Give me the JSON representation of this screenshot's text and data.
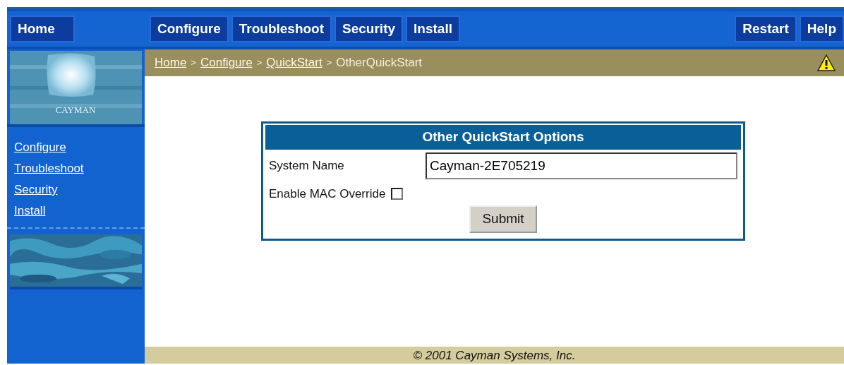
{
  "nav": {
    "home": {
      "label": "Home"
    },
    "main": [
      {
        "label": "Configure"
      },
      {
        "label": "Troubleshoot"
      },
      {
        "label": "Security"
      },
      {
        "label": "Install"
      }
    ],
    "right": [
      {
        "label": "Restart"
      },
      {
        "label": "Help"
      }
    ]
  },
  "logo": {
    "text": "CAYMAN"
  },
  "breadcrumb": {
    "links": [
      {
        "label": "Home"
      },
      {
        "label": "Configure"
      },
      {
        "label": "QuickStart"
      }
    ],
    "separator": ">",
    "current": "OtherQuickStart"
  },
  "sidebar": {
    "items": [
      {
        "label": "Configure"
      },
      {
        "label": "Troubleshoot"
      },
      {
        "label": "Security"
      },
      {
        "label": "Install"
      }
    ]
  },
  "form": {
    "title": "Other QuickStart Options",
    "fields": [
      {
        "kind": "text",
        "label": "System Name",
        "value": "Cayman-2E705219"
      },
      {
        "kind": "checkbox",
        "label": "Enable MAC Override",
        "checked": false
      }
    ],
    "submit": "Submit"
  },
  "footer": "© 2001 Cayman Systems, Inc."
}
